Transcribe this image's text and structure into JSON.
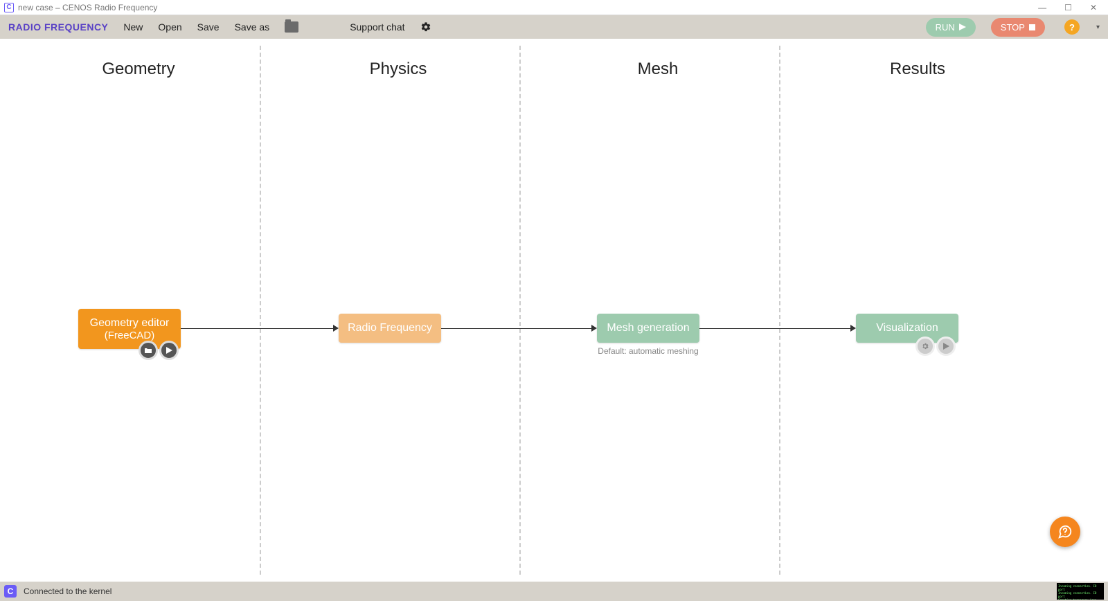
{
  "window": {
    "title": "new case – CENOS Radio Frequency"
  },
  "toolbar": {
    "brand": "RADIO FREQUENCY",
    "new": "New",
    "open": "Open",
    "save": "Save",
    "save_as": "Save as",
    "support_chat": "Support chat",
    "run": "RUN",
    "stop": "STOP",
    "help_symbol": "?"
  },
  "workflow": {
    "columns": {
      "geometry": "Geometry",
      "physics": "Physics",
      "mesh": "Mesh",
      "results": "Results"
    },
    "geometry_node": {
      "line1": "Geometry editor",
      "line2": "(FreeCAD)"
    },
    "physics_node": {
      "label": "Radio Frequency"
    },
    "mesh_node": {
      "label": "Mesh generation",
      "caption": "Default: automatic meshing"
    },
    "results_node": {
      "label": "Visualization"
    }
  },
  "statusbar": {
    "text": "Connected to the kernel"
  }
}
